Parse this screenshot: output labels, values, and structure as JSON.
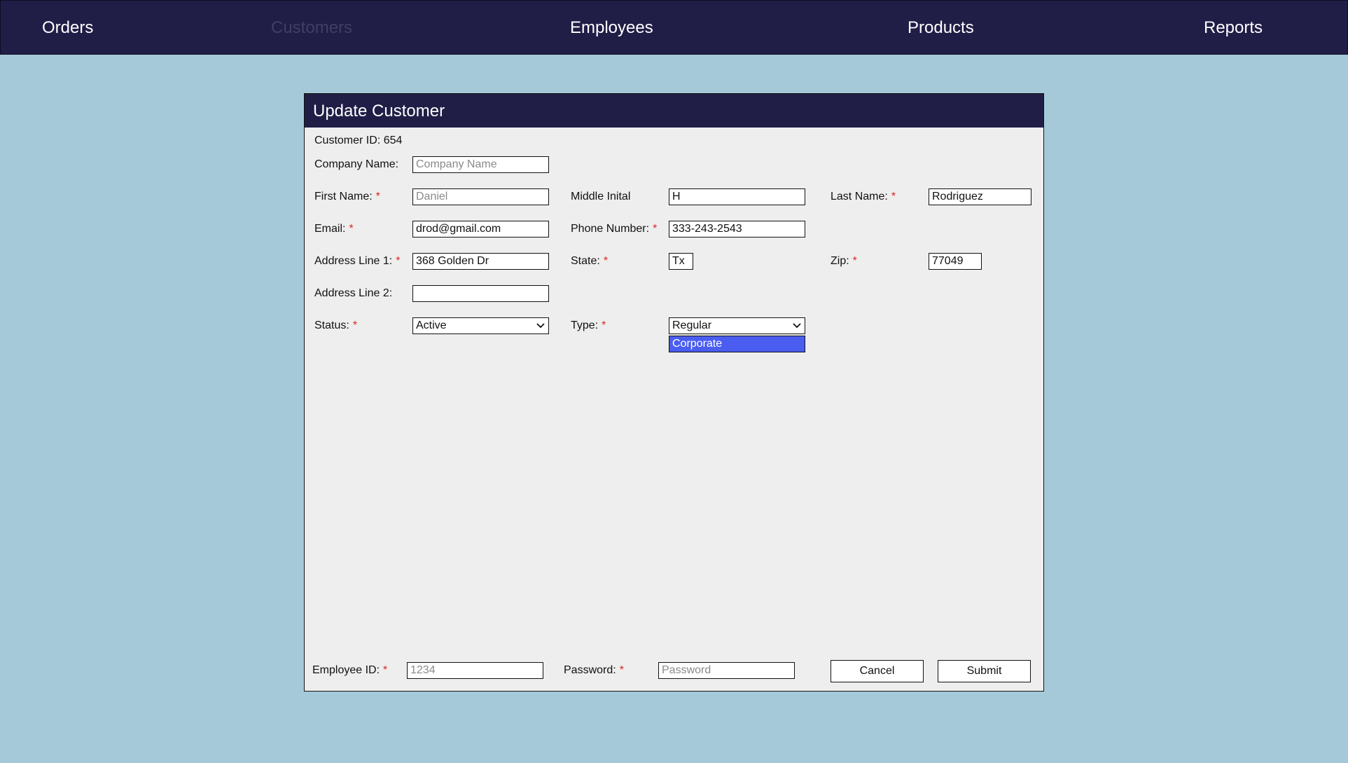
{
  "nav": {
    "items": [
      "Orders",
      "Customers",
      "Employees",
      "Products",
      "Reports"
    ],
    "active": "Customers"
  },
  "form": {
    "title": "Update Customer",
    "customer_id": "Customer ID: 654",
    "company_name": {
      "label": "Company Name:",
      "value": "",
      "placeholder": "Company Name"
    },
    "first_name": {
      "label": "First Name:",
      "value": "",
      "placeholder": "Daniel"
    },
    "middle_initial": {
      "label": "Middle Inital",
      "value": "H"
    },
    "last_name": {
      "label": "Last Name:",
      "value": "Rodriguez"
    },
    "email": {
      "label": "Email:",
      "value": "drod@gmail.com"
    },
    "phone": {
      "label": "Phone Number:",
      "value": "333-243-2543"
    },
    "address1": {
      "label": "Address Line 1:",
      "value": "368 Golden Dr"
    },
    "state": {
      "label": "State:",
      "value": "Tx"
    },
    "zip": {
      "label": "Zip:",
      "value": "77049"
    },
    "address2": {
      "label": "Address Line 2:",
      "value": ""
    },
    "status": {
      "label": "Status:",
      "value": "Active"
    },
    "type": {
      "label": "Type:",
      "value": "Regular",
      "open_option": "Corporate"
    },
    "required_marker": "*"
  },
  "footer": {
    "employee_id": {
      "label": "Employee ID:",
      "value": "",
      "placeholder": "1234"
    },
    "password": {
      "label": "Password:",
      "value": "",
      "placeholder": "Password"
    },
    "cancel_label": "Cancel",
    "submit_label": "Submit"
  },
  "colors": {
    "background": "#a5c9d9",
    "nav_bg": "#201e47",
    "nav_active_text": "#403e63",
    "panel_bg": "#eeeeee",
    "required": "#e22222",
    "dropdown_highlight": "#4a5df0"
  },
  "icons": {
    "select_arrow": "chevron-down-icon"
  }
}
